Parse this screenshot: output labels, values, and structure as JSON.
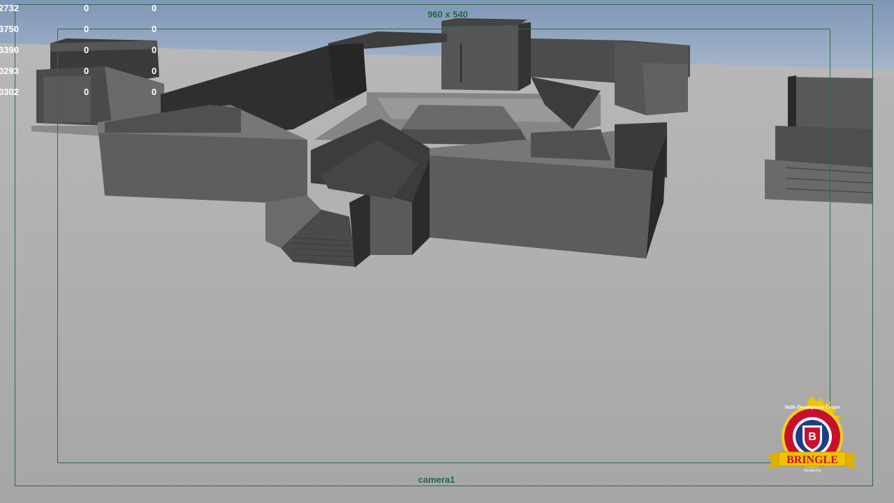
{
  "hud": {
    "rows": [
      {
        "label": "2732",
        "a": "0",
        "b": "0"
      },
      {
        "label": "3750",
        "a": "0",
        "b": "0"
      },
      {
        "label": "3390",
        "a": "0",
        "b": "0"
      },
      {
        "label": "0293",
        "a": "0",
        "b": "0"
      },
      {
        "label": "0302",
        "a": "0",
        "b": "0"
      }
    ]
  },
  "viewport": {
    "resolution": "960 x 540",
    "camera": "camera1"
  },
  "logo": {
    "arc_text": "Skills Development Centre",
    "name": "BRINGLE",
    "sub": "Academy"
  },
  "colors": {
    "sky": "#8fa4c0",
    "ground": "#a9a9a9",
    "gate": "#2f6a4a",
    "hud_text": "#ffffff",
    "badge_gold": "#f2c200",
    "badge_red": "#c8102e"
  }
}
